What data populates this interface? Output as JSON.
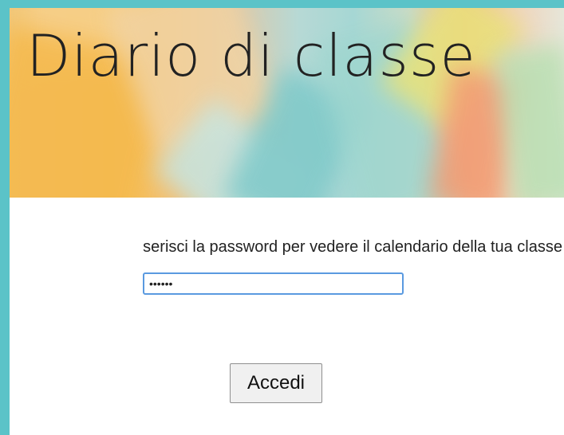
{
  "header": {
    "title": "Diario di classe"
  },
  "login": {
    "prompt": "serisci la password per vedere il calendario della tua classe",
    "password_value": "••••••",
    "button_label": "Accedi"
  },
  "colors": {
    "frame": "#5bc3c8",
    "input_focus_border": "#5a9ae0",
    "button_bg": "#f0f0f0"
  }
}
